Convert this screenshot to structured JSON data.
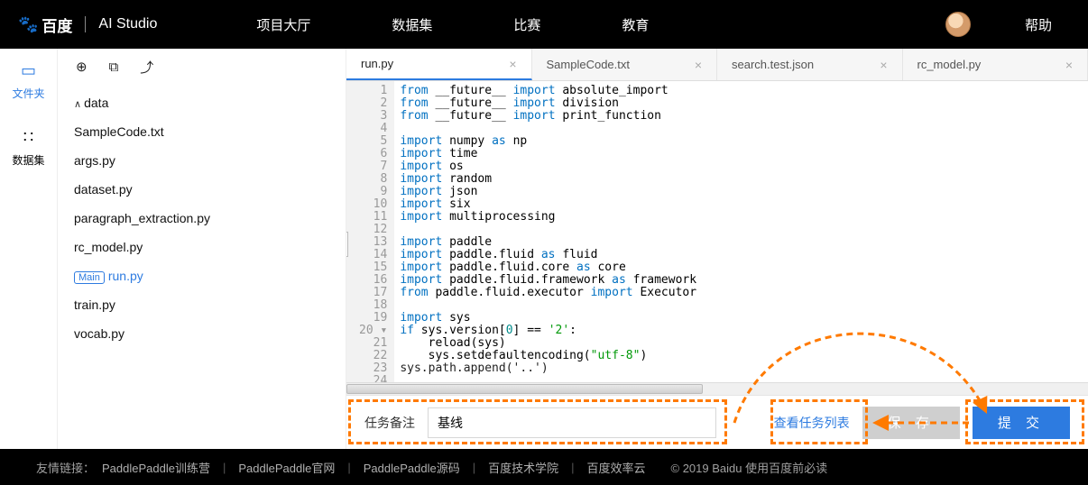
{
  "nav": {
    "brand_baidu": "百度",
    "brand_studio": "AI Studio",
    "items": [
      "项目大厅",
      "数据集",
      "比赛",
      "教育"
    ],
    "help": "帮助"
  },
  "rail": {
    "files_label": "文件夹",
    "dataset_label": "数据集"
  },
  "tree": {
    "folder": "data",
    "files": [
      "SampleCode.txt",
      "args.py",
      "dataset.py",
      "paragraph_extraction.py",
      "rc_model.py",
      "run.py",
      "train.py",
      "vocab.py"
    ],
    "main_badge": "Main",
    "main_file": "run.py"
  },
  "tabs": [
    {
      "label": "run.py",
      "active": true
    },
    {
      "label": "SampleCode.txt",
      "active": false
    },
    {
      "label": "search.test.json",
      "active": false
    },
    {
      "label": "rc_model.py",
      "active": false
    }
  ],
  "code": {
    "lines": [
      {
        "t": "from",
        "a": "__future__",
        "k": "import",
        "b": "absolute_import"
      },
      {
        "t": "from",
        "a": "__future__",
        "k": "import",
        "b": "division"
      },
      {
        "t": "from",
        "a": "__future__",
        "k": "import",
        "b": "print_function"
      },
      {
        "blank": true
      },
      {
        "t": "import",
        "a": "numpy",
        "k": "as",
        "b": "np"
      },
      {
        "t": "import",
        "a": "time"
      },
      {
        "t": "import",
        "a": "os"
      },
      {
        "t": "import",
        "a": "random"
      },
      {
        "t": "import",
        "a": "json"
      },
      {
        "t": "import",
        "a": "six"
      },
      {
        "t": "import",
        "a": "multiprocessing"
      },
      {
        "blank": true
      },
      {
        "t": "import",
        "a": "paddle"
      },
      {
        "t": "import",
        "a": "paddle.fluid",
        "k": "as",
        "b": "fluid"
      },
      {
        "t": "import",
        "a": "paddle.fluid.core",
        "k": "as",
        "b": "core"
      },
      {
        "t": "import",
        "a": "paddle.fluid.framework",
        "k": "as",
        "b": "framework"
      },
      {
        "t": "from",
        "a": "paddle.fluid.executor",
        "k": "import",
        "b": "Executor"
      },
      {
        "blank": true
      },
      {
        "t": "import",
        "a": "sys"
      },
      {
        "raw_prefix": "if ",
        "mid": "sys.version[",
        "num": "0",
        "mid2": "] == ",
        "str": "'2'",
        "suffix": ":",
        "fold": true
      },
      {
        "indent": true,
        "call": "reload(sys)"
      },
      {
        "indent": true,
        "call_pre": "sys.setdefaultencoding(",
        "str": "\"utf-8\"",
        "call_post": ")"
      },
      {
        "raw": "sys.path.append('..')"
      },
      {
        "blank": true
      }
    ]
  },
  "bottombar": {
    "remark_label": "任务备注",
    "remark_value": "基线",
    "task_list": "查看任务列表",
    "save": "保 存",
    "submit": "提 交"
  },
  "footer": {
    "prefix": "友情链接：",
    "links": [
      "PaddlePaddle训练营",
      "PaddlePaddle官网",
      "PaddlePaddle源码",
      "百度技术学院",
      "百度效率云"
    ],
    "copyright": "© 2019 Baidu 使用百度前必读"
  }
}
